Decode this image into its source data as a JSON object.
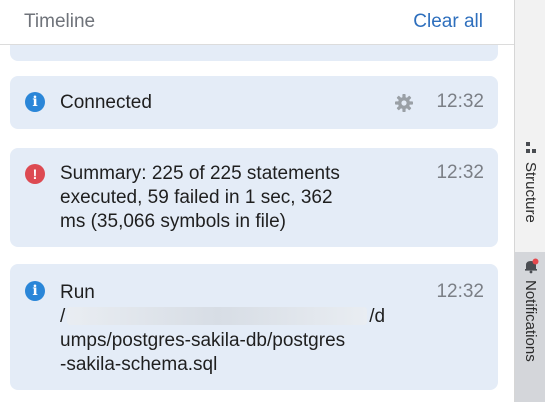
{
  "header": {
    "title": "Timeline",
    "clear_all_label": "Clear all"
  },
  "notifications": {
    "connected": {
      "type": "info",
      "icon": "info-icon",
      "text": "Connected",
      "time": "12:32"
    },
    "summary": {
      "type": "error",
      "icon": "error-icon",
      "lines": [
        "Summary: 225 of 225 statements",
        "executed, 59 failed in 1 sec, 362",
        "ms (35,066 symbols in file)"
      ],
      "time": "12:32"
    },
    "run": {
      "type": "info",
      "icon": "info-icon",
      "line1": "Run",
      "path_start": "/",
      "path_end": "/d",
      "line3": "umps/postgres-sakila-db/postgres",
      "line4": "-sakila-schema.sql",
      "time": "12:32"
    }
  },
  "sidebar": {
    "tabs": [
      {
        "label": "Structure",
        "icon": "structure-icon"
      },
      {
        "label": "Notifications",
        "icon": "bell-icon",
        "selected": true
      }
    ]
  },
  "colors": {
    "card_bg": "#e4ecf7",
    "accent": "#2e6fbd",
    "info": "#2a86d8",
    "error": "#dd4a52"
  }
}
